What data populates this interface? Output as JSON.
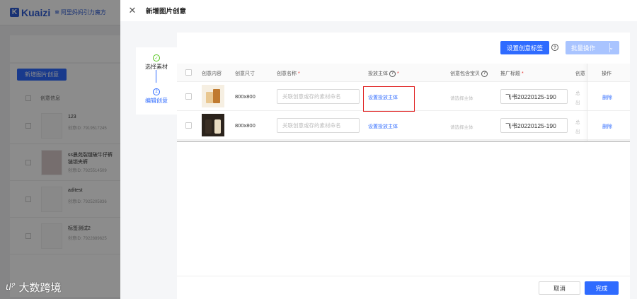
{
  "background": {
    "logo": "Kuaizi",
    "logo_sub": "阿里妈妈引力魔方",
    "new_button": "新增图片创意",
    "column_header": "创意信息",
    "items": [
      {
        "name": "123",
        "id": "创意ID: 7919517245"
      },
      {
        "name": "ss晨苑裂缝破牛仔裤",
        "name2": "链锁夹裤",
        "id": "创意ID: 7925514509"
      },
      {
        "name": "aditest",
        "id": "创意ID: 7925205836"
      },
      {
        "name": "标签测试2",
        "id": "创意ID: 7922889625"
      }
    ]
  },
  "watermark": {
    "mark": "ιŀ°",
    "text": "大数跨境"
  },
  "drawer": {
    "title": "新增图片创意",
    "steps": [
      {
        "label": "选择素材",
        "icon": "✓"
      },
      {
        "label": "编辑创意",
        "icon": "2"
      }
    ],
    "toolbar": {
      "set_tag": "设置创意标签",
      "batch": "批量操作",
      "batch_caret": "⌄"
    },
    "table": {
      "headers": {
        "content": "创意内容",
        "size": "创意尺寸",
        "name": "创意名称",
        "subject": "投放主体",
        "landing": "创意包含宝贝",
        "promo_title": "推广标题",
        "col7": "创意",
        "actions": "操作"
      },
      "rows": [
        {
          "size": "800x800",
          "name_placeholder": "关联创意或存的素材命名",
          "subject_link": "设置投放主体",
          "landing": "请选择主体",
          "promo_title": "飞书20220125-190",
          "col7a": "总",
          "col7b": "出",
          "delete": "删除",
          "thumb_colors": [
            "#e9c790",
            "#c07a2f"
          ]
        },
        {
          "size": "800x800",
          "name_placeholder": "关联创意或存的素材命名",
          "subject_link": "设置投放主体",
          "landing": "请选择主体",
          "promo_title": "飞书20220125-190",
          "col7a": "总",
          "col7b": "出",
          "delete": "删除",
          "thumb_colors": [
            "#3a2e24",
            "#e9dcc2"
          ]
        }
      ]
    },
    "footer": {
      "cancel": "取消",
      "done": "完成"
    },
    "colors": {
      "primary": "#2f6bff",
      "highlight": "#e02020",
      "success": "#52c41a"
    }
  }
}
